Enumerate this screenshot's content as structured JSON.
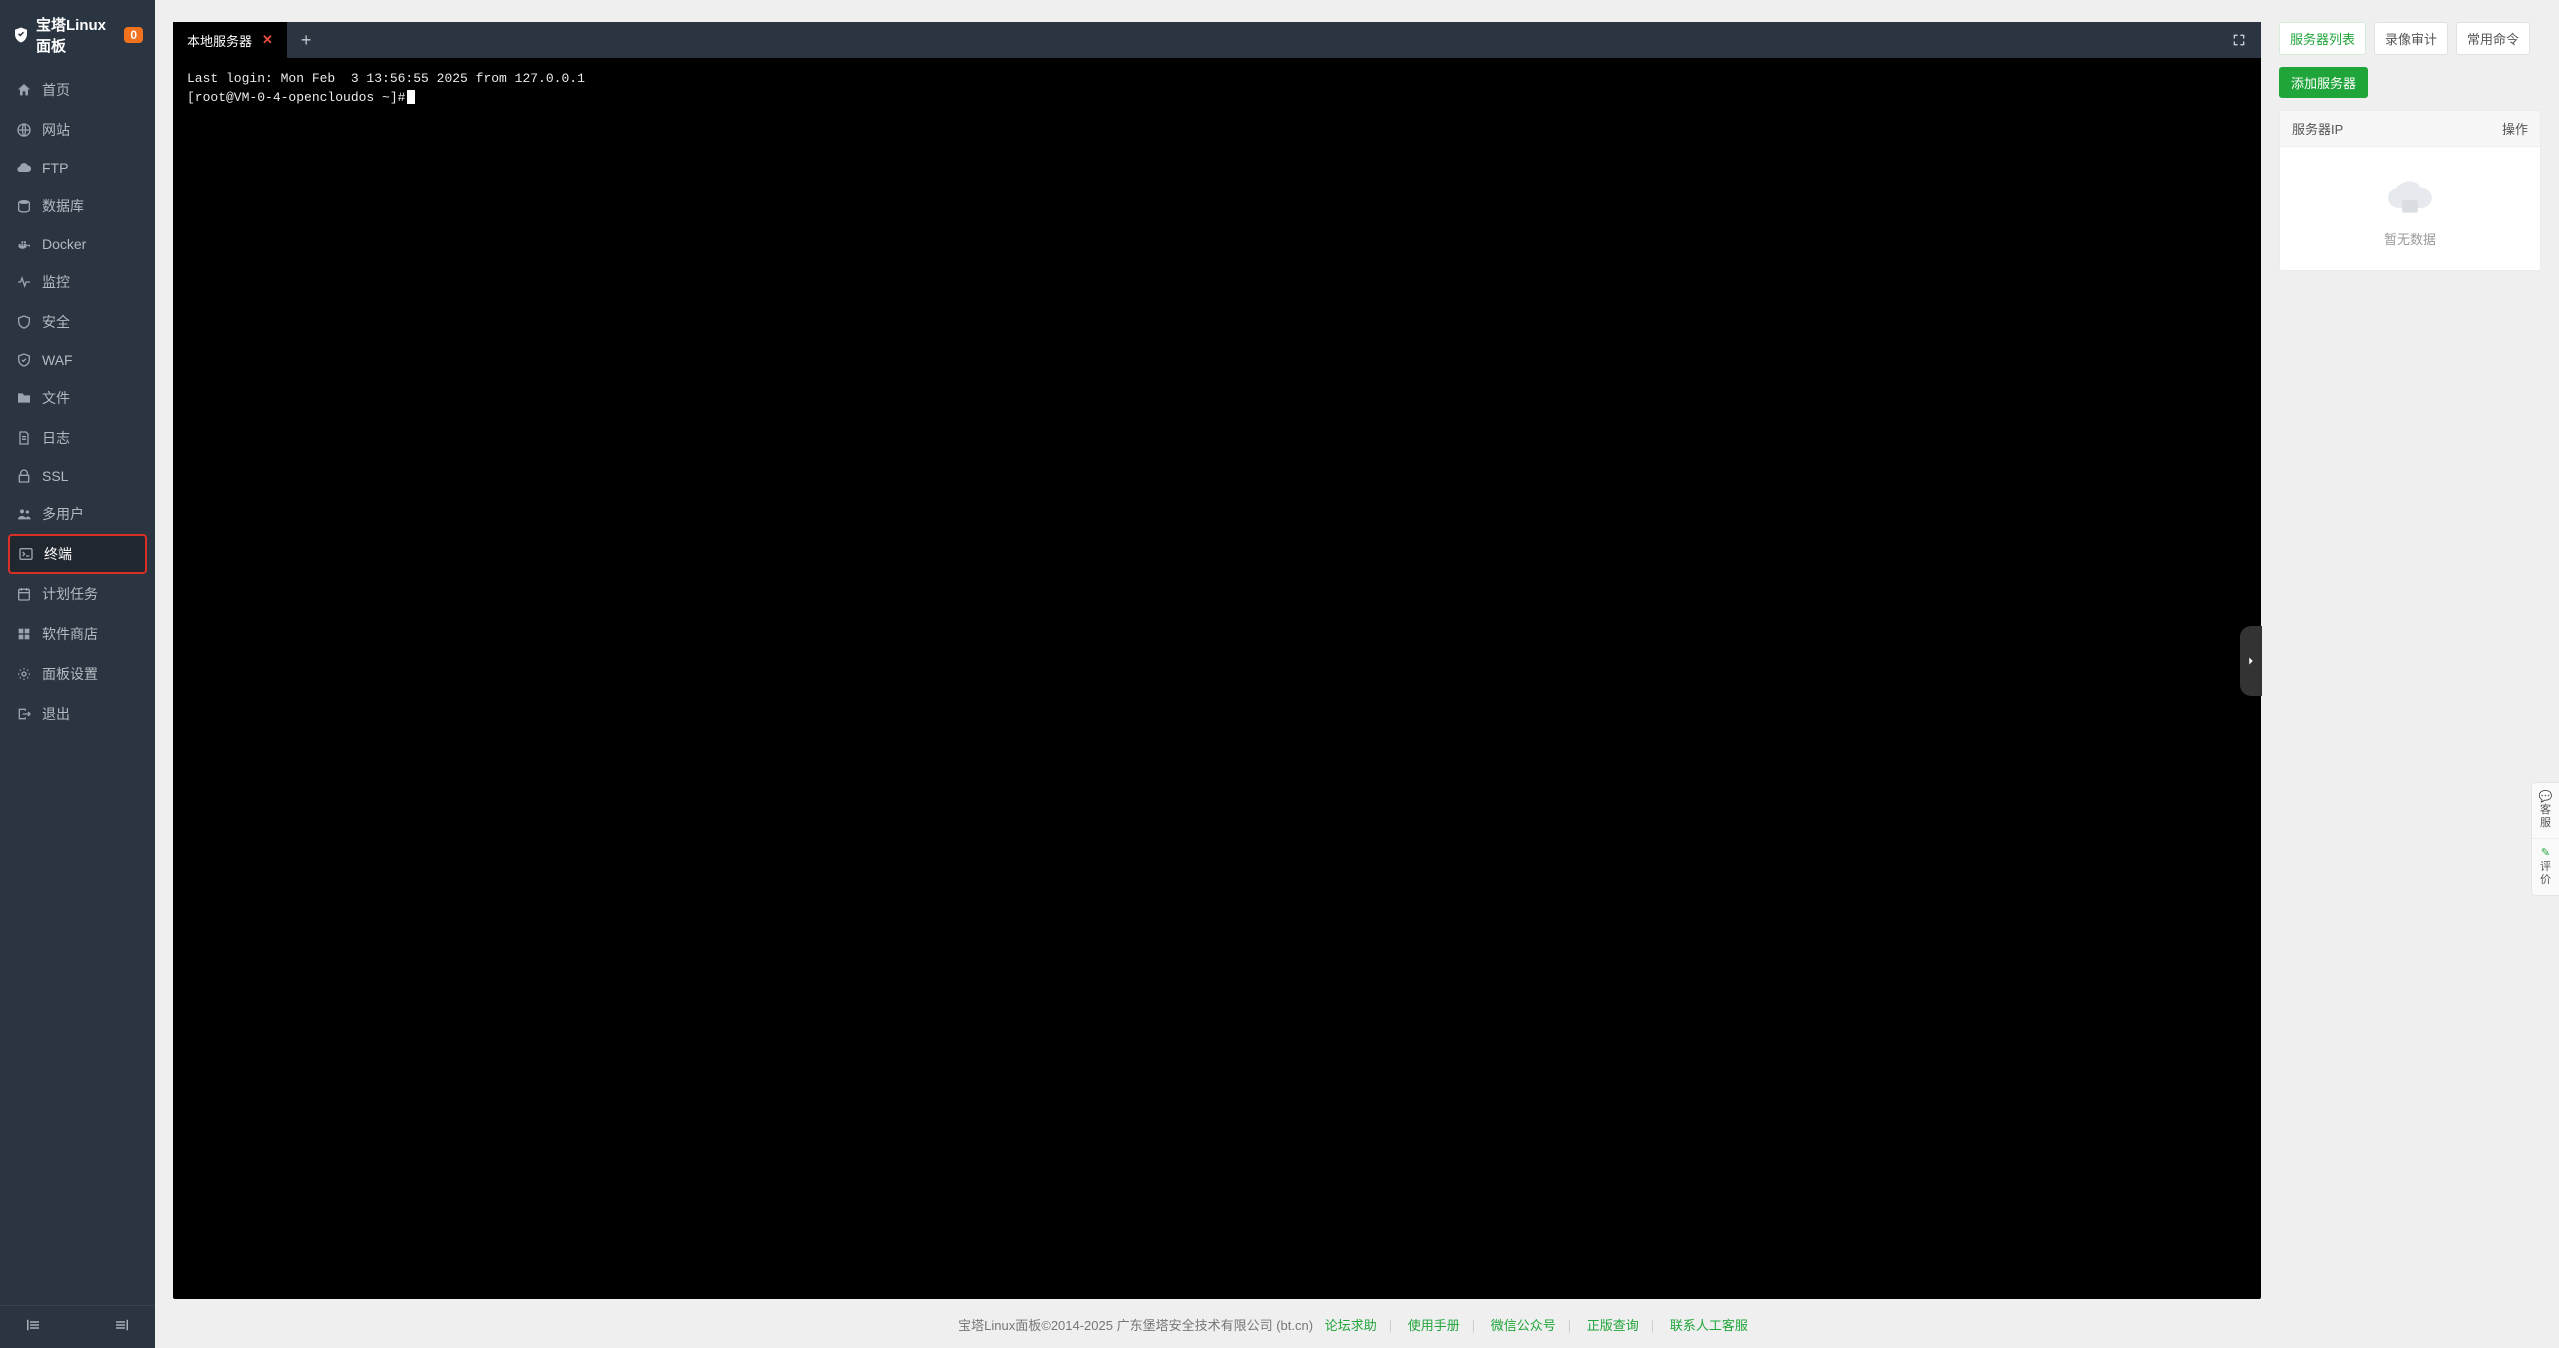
{
  "brand": {
    "title": "宝塔Linux面板",
    "badge": "0"
  },
  "sidebar": {
    "items": [
      {
        "id": "home",
        "label": "首页"
      },
      {
        "id": "site",
        "label": "网站"
      },
      {
        "id": "ftp",
        "label": "FTP"
      },
      {
        "id": "db",
        "label": "数据库"
      },
      {
        "id": "docker",
        "label": "Docker"
      },
      {
        "id": "monitor",
        "label": "监控"
      },
      {
        "id": "security",
        "label": "安全"
      },
      {
        "id": "waf",
        "label": "WAF"
      },
      {
        "id": "files",
        "label": "文件"
      },
      {
        "id": "logs",
        "label": "日志"
      },
      {
        "id": "ssl",
        "label": "SSL"
      },
      {
        "id": "multiuser",
        "label": "多用户"
      },
      {
        "id": "terminal",
        "label": "终端"
      },
      {
        "id": "cron",
        "label": "计划任务"
      },
      {
        "id": "soft",
        "label": "软件商店"
      },
      {
        "id": "panel",
        "label": "面板设置"
      },
      {
        "id": "logout",
        "label": "退出"
      }
    ]
  },
  "terminal": {
    "tab_title": "本地服务器",
    "lines": [
      "Last login: Mon Feb  3 13:56:55 2025 from 127.0.0.1",
      "[root@VM-0-4-opencloudos ~]#"
    ]
  },
  "right": {
    "tabs": [
      {
        "id": "servers",
        "label": "服务器列表"
      },
      {
        "id": "records",
        "label": "录像审计"
      },
      {
        "id": "commands",
        "label": "常用命令"
      }
    ],
    "add_btn": "添加服务器",
    "col_ip": "服务器IP",
    "col_op": "操作",
    "empty": "暂无数据"
  },
  "footer": {
    "copyright": "宝塔Linux面板©2014-2025 广东堡塔安全技术有限公司 (bt.cn)",
    "links": [
      "论坛求助",
      "使用手册",
      "微信公众号",
      "正版查询",
      "联系人工客服"
    ]
  },
  "float": {
    "kf": "客服",
    "pj": "评价"
  }
}
